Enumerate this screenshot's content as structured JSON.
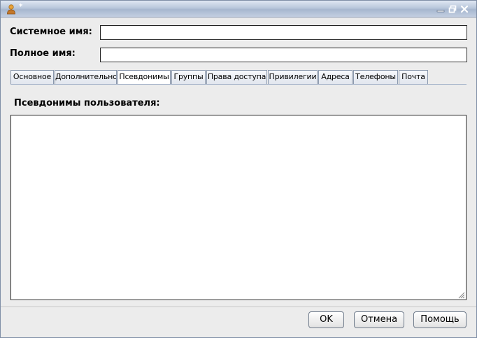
{
  "window": {
    "title": "*",
    "colors": {
      "titlebar": "#b9c7dc",
      "background": "#ececec"
    }
  },
  "fields": {
    "system_name": {
      "label": "Системное имя:",
      "value": ""
    },
    "full_name": {
      "label": "Полное имя:",
      "value": ""
    }
  },
  "tabs": [
    {
      "label": "Основное",
      "active": false
    },
    {
      "label": "Дополнительно",
      "active": false
    },
    {
      "label": "Псевдонимы",
      "active": true
    },
    {
      "label": "Группы",
      "active": false
    },
    {
      "label": "Права доступа",
      "active": false
    },
    {
      "label": "Привилегии",
      "active": false
    },
    {
      "label": "Адреса",
      "active": false
    },
    {
      "label": "Телефоны",
      "active": false
    },
    {
      "label": "Почта",
      "active": false
    }
  ],
  "panel": {
    "title": "Псевдонимы пользователя:",
    "aliases_value": ""
  },
  "buttons": {
    "ok": "OK",
    "cancel": "Отмена",
    "help": "Помощь"
  }
}
